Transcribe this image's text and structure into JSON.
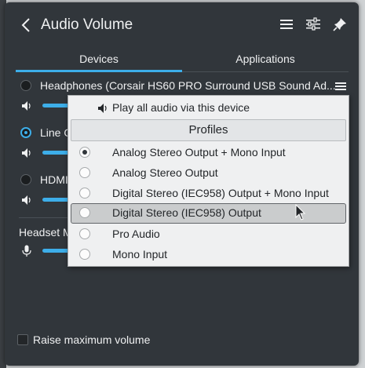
{
  "header": {
    "title": "Audio Volume",
    "back_icon": "chevron-left-icon",
    "icons": [
      "hamburger-menu-icon",
      "configure-sliders-icon",
      "pin-icon"
    ]
  },
  "tabs": [
    {
      "label": "Devices",
      "active": true
    },
    {
      "label": "Applications",
      "active": false
    }
  ],
  "devices": [
    {
      "name": "Headphones (Corsair HS60 PRO Surround USB Sound Ad...",
      "selected": false,
      "volume": 0.1
    },
    {
      "name": "Line O",
      "selected": true,
      "volume": 0.1
    },
    {
      "name": "HDMI",
      "selected": false,
      "volume": 0.1
    }
  ],
  "inputs_section": {
    "label": "Headset M",
    "volume": 0.1
  },
  "footer": {
    "raise_max_label": "Raise maximum volume",
    "raise_max_checked": false
  },
  "context_menu": {
    "play_all_label": "Play all audio via this device",
    "section_title": "Profiles",
    "profiles": [
      {
        "label": "Analog Stereo Output + Mono Input",
        "checked": true
      },
      {
        "label": "Analog Stereo Output",
        "checked": false
      },
      {
        "label": "Digital Stereo (IEC958) Output + Mono Input",
        "checked": false
      },
      {
        "label": "Digital Stereo (IEC958) Output",
        "checked": false,
        "highlighted": true
      },
      {
        "label": "Pro Audio",
        "checked": false
      },
      {
        "label": "Mono Input",
        "checked": false
      }
    ]
  },
  "colors": {
    "accent": "#3daee9",
    "panel_bg": "#31363b",
    "menu_bg": "#eff0f1"
  }
}
